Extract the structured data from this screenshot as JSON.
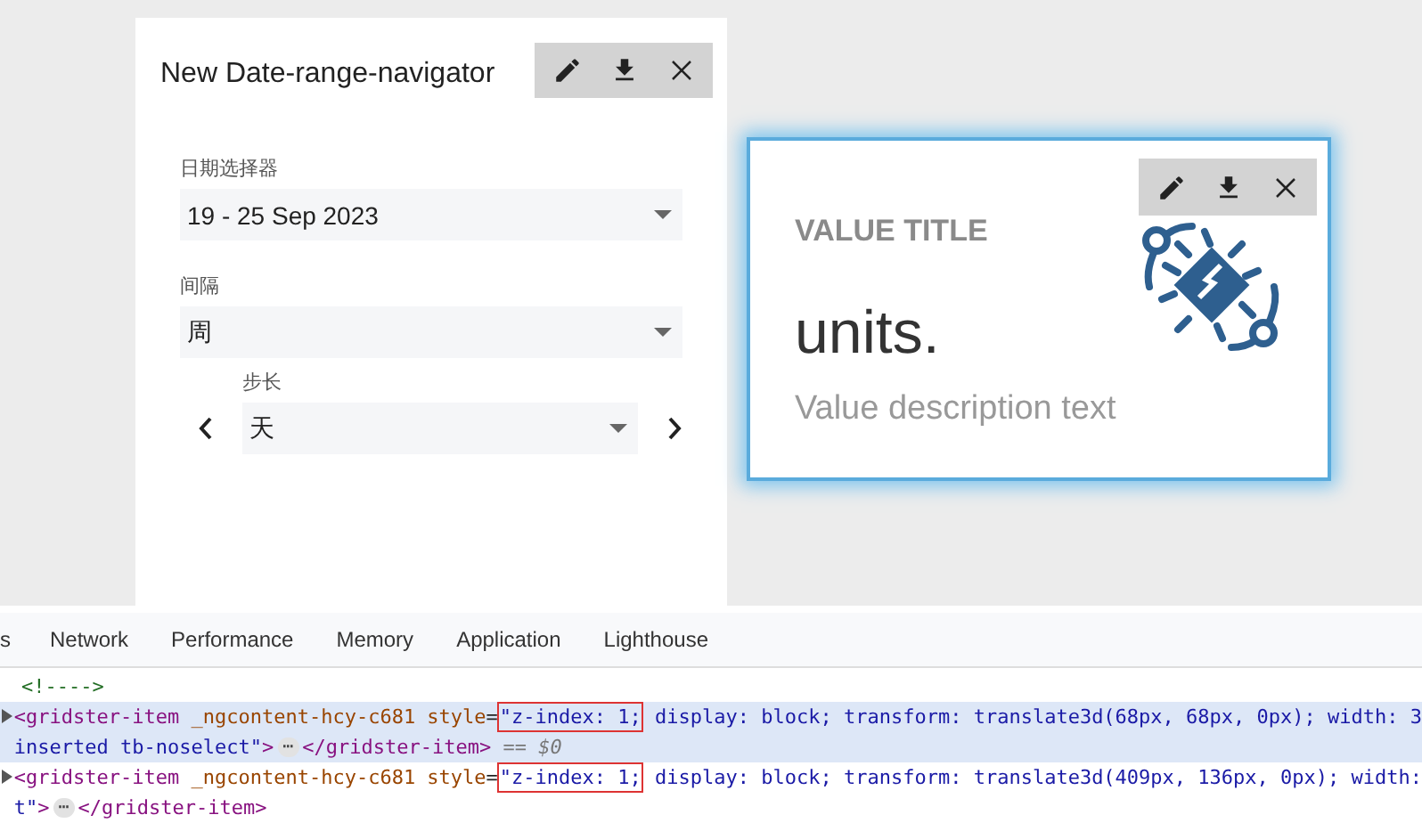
{
  "date_range_widget": {
    "title": "New Date-range-navigator",
    "fields": [
      {
        "label": "日期选择器",
        "value": "19 - 25 Sep 2023"
      },
      {
        "label": "间隔",
        "value": "周"
      }
    ],
    "step": {
      "label": "步长",
      "value": "天"
    }
  },
  "value_widget": {
    "title": "VALUE TITLE",
    "units": "units.",
    "description": "Value description text",
    "focused": true
  },
  "devtools": {
    "tabs": [
      "s",
      "Network",
      "Performance",
      "Memory",
      "Application",
      "Lighthouse"
    ],
    "nodes": [
      {
        "selected": false,
        "expandable": false,
        "lines": [
          [
            {
              "kind": "comment",
              "text": "<!---->"
            }
          ]
        ]
      },
      {
        "selected": true,
        "expandable": true,
        "lines": [
          [
            {
              "kind": "tag",
              "text": "<gridster-item"
            },
            {
              "kind": "attr",
              "text": " _ngcontent-hcy-c681 style"
            },
            {
              "kind": "plain",
              "text": "="
            },
            {
              "kind": "boxed",
              "text": "\"z-index: 1;"
            },
            {
              "kind": "value",
              "text": " display: block; transform: translate3d(68px, 68px, 0px); width: 3"
            }
          ],
          [
            {
              "kind": "value",
              "text": "inserted tb-noselect\""
            },
            {
              "kind": "tag",
              "text": ">"
            },
            {
              "kind": "ellipsis",
              "text": "⋯"
            },
            {
              "kind": "tag",
              "text": "</gridster-item>"
            },
            {
              "kind": "dim",
              "text": " == $0"
            }
          ]
        ]
      },
      {
        "selected": false,
        "expandable": true,
        "lines": [
          [
            {
              "kind": "tag",
              "text": "<gridster-item"
            },
            {
              "kind": "attr",
              "text": " _ngcontent-hcy-c681 style"
            },
            {
              "kind": "plain",
              "text": "="
            },
            {
              "kind": "boxed",
              "text": "\"z-index: 1;"
            },
            {
              "kind": "value",
              "text": " display: block; transform: translate3d(409px, 136px, 0px); width:"
            }
          ],
          [
            {
              "kind": "value",
              "text": "t\""
            },
            {
              "kind": "tag",
              "text": ">"
            },
            {
              "kind": "ellipsis",
              "text": "⋯"
            },
            {
              "kind": "tag",
              "text": "</gridster-item>"
            }
          ]
        ]
      }
    ]
  }
}
